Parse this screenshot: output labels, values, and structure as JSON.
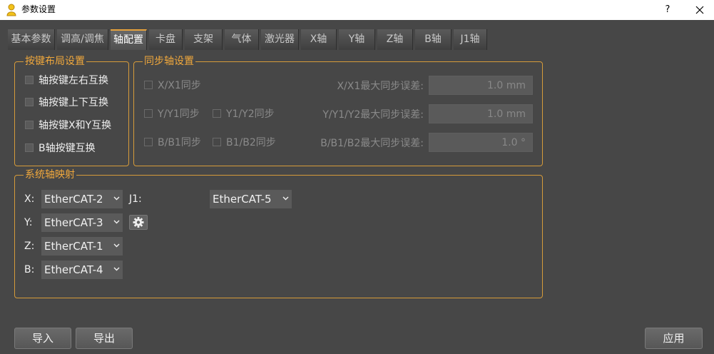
{
  "window": {
    "title": "参数设置",
    "help_label": "?",
    "close_icon": "close-icon",
    "app_icon": "user-icon"
  },
  "tabs": [
    {
      "label": "基本参数"
    },
    {
      "label": "调高/调焦"
    },
    {
      "label": "轴配置",
      "active": true
    },
    {
      "label": "卡盘"
    },
    {
      "label": "支架"
    },
    {
      "label": "气体"
    },
    {
      "label": "激光器"
    },
    {
      "label": "X轴"
    },
    {
      "label": "Y轴"
    },
    {
      "label": "Z轴"
    },
    {
      "label": "B轴"
    },
    {
      "label": "J1轴"
    }
  ],
  "key_layout": {
    "title": "按键布局设置",
    "items": [
      {
        "label": "轴按键左右互换",
        "checked": false
      },
      {
        "label": "轴按键上下互换",
        "checked": false
      },
      {
        "label": "轴按键X和Y互换",
        "checked": false
      },
      {
        "label": "B轴按键互换",
        "checked": false
      }
    ]
  },
  "sync_axis": {
    "title": "同步轴设置",
    "checks": {
      "xx1": "X/X1同步",
      "yy1": "Y/Y1同步",
      "y1y2": "Y1/Y2同步",
      "bb1": "B/B1同步",
      "b1b2": "B1/B2同步"
    },
    "errors": [
      {
        "label": "X/X1最大同步误差:",
        "value": "1.0 mm"
      },
      {
        "label": "Y/Y1/Y2最大同步误差:",
        "value": "1.0 mm"
      },
      {
        "label": "B/B1/B2最大同步误差:",
        "value": "1.0 °"
      }
    ]
  },
  "axis_mapping": {
    "title": "系统轴映射",
    "axes": [
      {
        "label": "X:",
        "value": "EtherCAT-2"
      },
      {
        "label": "Y:",
        "value": "EtherCAT-3"
      },
      {
        "label": "Z:",
        "value": "EtherCAT-1"
      },
      {
        "label": "B:",
        "value": "EtherCAT-4"
      }
    ],
    "j1": {
      "label": "J1:",
      "value": "EtherCAT-5"
    },
    "gear_icon": "gear-icon"
  },
  "footer": {
    "import": "导入",
    "export": "导出",
    "apply": "应用"
  },
  "colors": {
    "accent": "#d69b3a",
    "background": "#474747"
  }
}
